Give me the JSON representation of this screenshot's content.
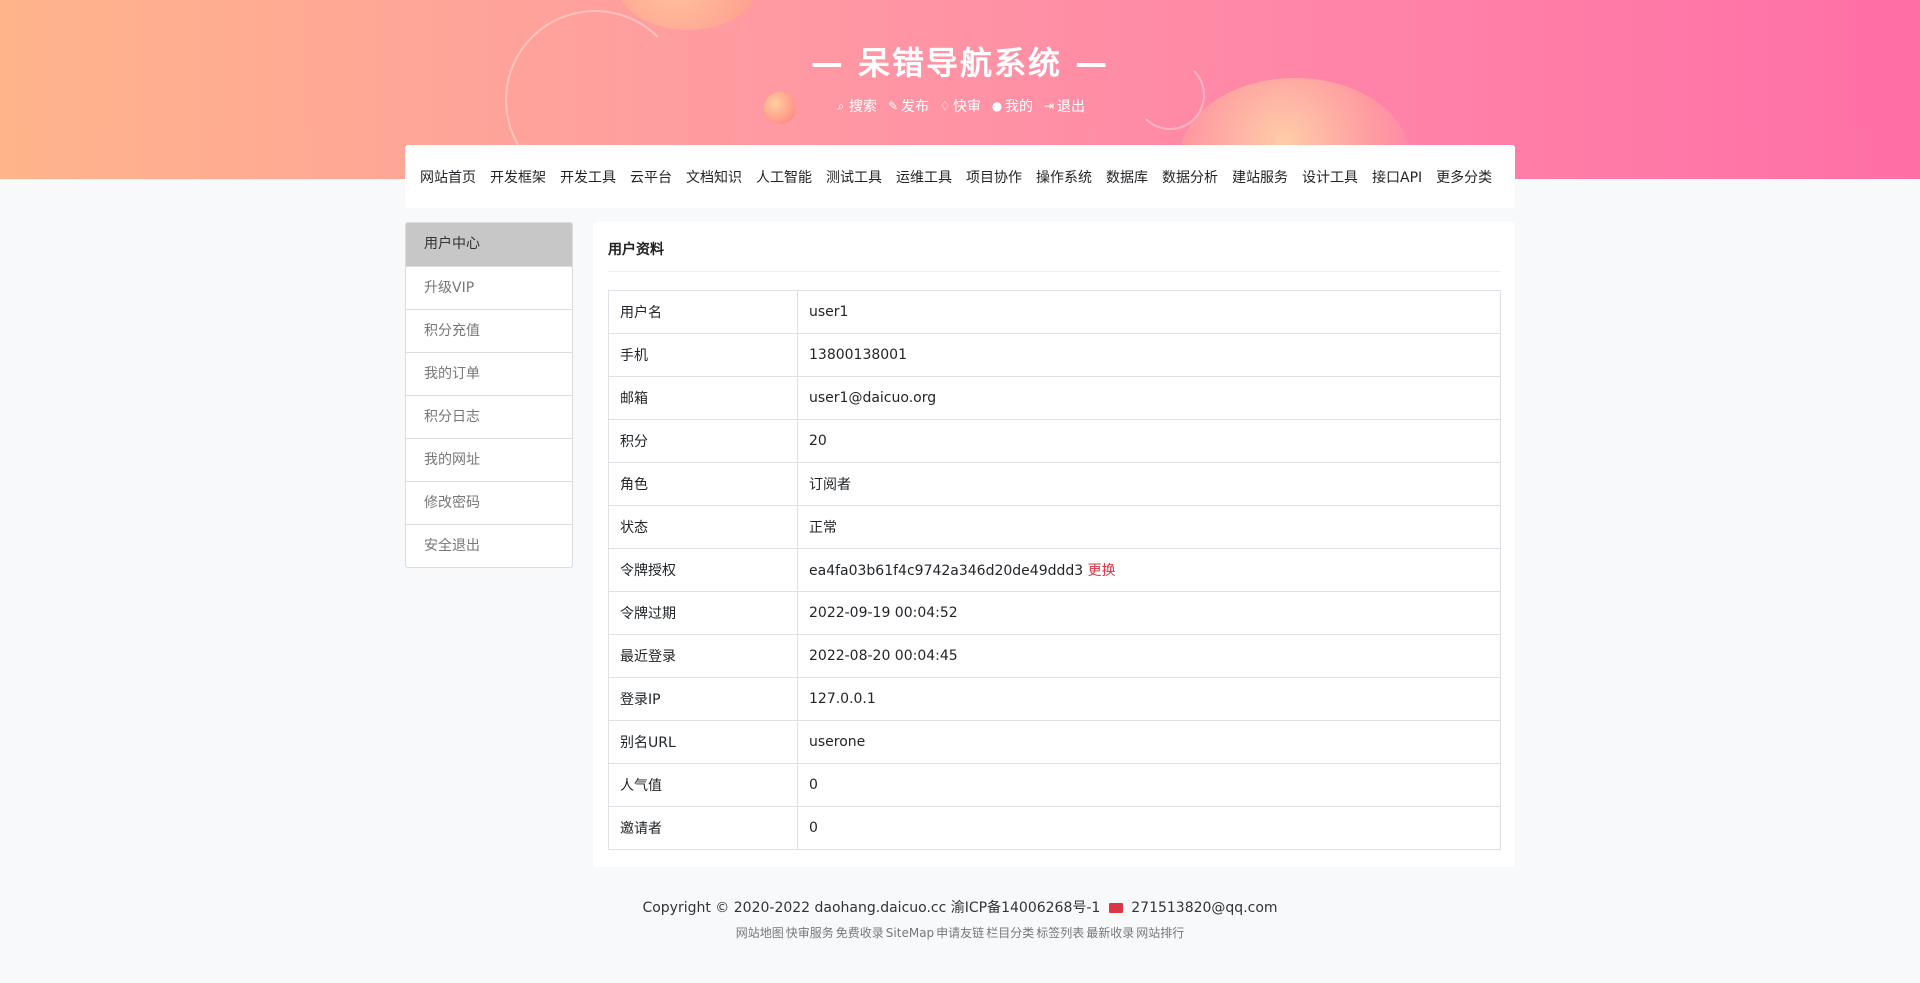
{
  "header": {
    "title": "— 呆错导航系统 —",
    "quick_links": [
      {
        "icon": "search-icon",
        "glyph": "⌕",
        "label": "搜索"
      },
      {
        "icon": "edit-icon",
        "glyph": "✎",
        "label": "发布"
      },
      {
        "icon": "diamond-icon",
        "glyph": "♢",
        "label": "快审"
      },
      {
        "icon": "user-icon",
        "glyph": "●",
        "label": "我的"
      },
      {
        "icon": "sign-out-icon",
        "glyph": "⇥",
        "label": "退出"
      }
    ]
  },
  "nav": {
    "items": [
      "网站首页",
      "开发框架",
      "开发工具",
      "云平台",
      "文档知识",
      "人工智能",
      "测试工具",
      "运维工具",
      "项目协作",
      "操作系统",
      "数据库",
      "数据分析",
      "建站服务",
      "设计工具",
      "接口API",
      "更多分类"
    ]
  },
  "sidebar": {
    "items": [
      "用户中心",
      "升级VIP",
      "积分充值",
      "我的订单",
      "积分日志",
      "我的网址",
      "修改密码",
      "安全退出"
    ],
    "active": "用户中心"
  },
  "profile": {
    "title": "用户资料",
    "rows": [
      {
        "key": "用户名",
        "value": "user1"
      },
      {
        "key": "手机",
        "value": "13800138001"
      },
      {
        "key": "邮箱",
        "value": "user1@daicuo.org"
      },
      {
        "key": "积分",
        "value": "20"
      },
      {
        "key": "角色",
        "value": "订阅者"
      },
      {
        "key": "状态",
        "value": "正常"
      },
      {
        "key": "令牌授权",
        "value": "ea4fa03b61f4c9742a346d20de49ddd3",
        "action": "更换"
      },
      {
        "key": "令牌过期",
        "value": "2022-09-19 00:04:52"
      },
      {
        "key": "最近登录",
        "value": "2022-08-20 00:04:45"
      },
      {
        "key": "登录IP",
        "value": "127.0.0.1"
      },
      {
        "key": "别名URL",
        "value": "userone"
      },
      {
        "key": "人气值",
        "value": "0"
      },
      {
        "key": "邀请者",
        "value": "0"
      }
    ]
  },
  "footer": {
    "copyright": "Copyright © 2020-2022 daohang.daicuo.cc",
    "icp": "渝ICP备14006268号-1",
    "email": "271513820@qq.com",
    "links": [
      "网站地图",
      "快审服务",
      "免费收录",
      "SiteMap",
      "申请友链",
      "栏目分类",
      "标签列表",
      "最新收录",
      "网站排行"
    ]
  },
  "colors": {
    "accent": "#ff7ea8",
    "danger": "#dc3545",
    "active_sidebar": "#c7c7c7"
  }
}
